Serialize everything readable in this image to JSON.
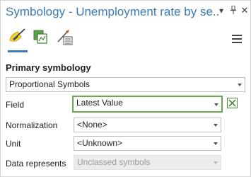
{
  "pane": {
    "title": "Symbology - Unemployment rate  by se...",
    "menu_icon": "chevron-down-icon",
    "pin_icon": "pin-icon",
    "close_icon": "close-icon"
  },
  "tabs": [
    {
      "name": "primary-symbology-tab",
      "icon": "paintbrush-icon",
      "active": true
    },
    {
      "name": "vary-symbology-tab",
      "icon": "layers-icon",
      "active": false
    },
    {
      "name": "advanced-symbology-tab",
      "icon": "brush-options-icon",
      "active": false
    }
  ],
  "options_icon": "hamburger-menu-icon",
  "primary": {
    "label": "Primary symbology",
    "selected": "Proportional Symbols"
  },
  "fields": [
    {
      "label": "Field",
      "value": "Latest Value",
      "state": "focus"
    },
    {
      "label": "Normalization",
      "value": "<None>",
      "state": "normal"
    },
    {
      "label": "Unit",
      "value": "<Unknown>",
      "state": "normal"
    },
    {
      "label": "Data represents",
      "value": "Unclassed symbols",
      "state": "disabled"
    }
  ],
  "expression_icon": "expression-builder-icon",
  "colors": {
    "title": "#3a7ab8",
    "focus_border": "#6aa84f"
  }
}
